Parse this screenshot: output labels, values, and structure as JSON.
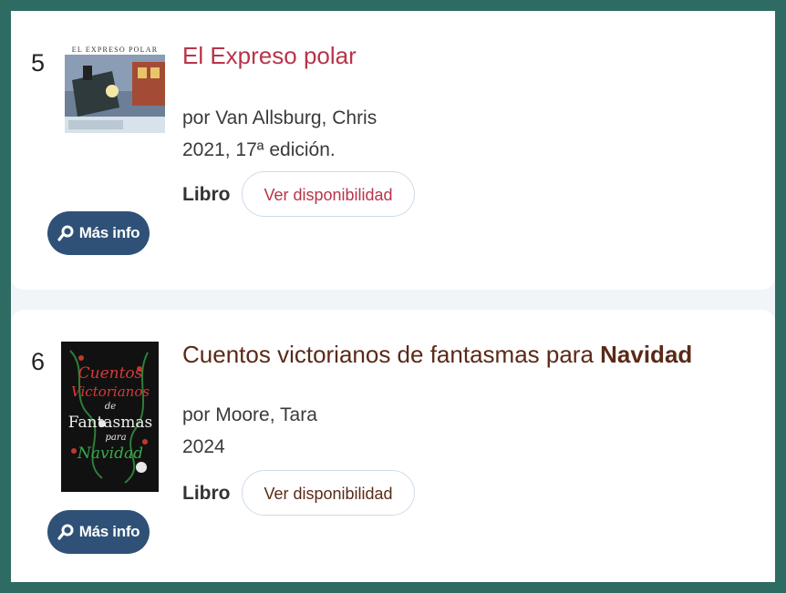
{
  "results": [
    {
      "number": "5",
      "title": "El Expreso polar",
      "title_plain": "El Expreso polar",
      "title_highlight": "",
      "author_prefix": "por",
      "author": "Van Allsburg, Chris",
      "edition": "2021, 17ª edición.",
      "type": "Libro",
      "availability_label": "Ver disponibilidad",
      "more_info_label": "Más info",
      "cover_text": "EL EXPRESO POLAR"
    },
    {
      "number": "6",
      "title_plain": "Cuentos victorianos de fantasmas para ",
      "title_highlight": "Navidad",
      "author_prefix": "por",
      "author": "Moore, Tara",
      "edition": "2024",
      "type": "Libro",
      "availability_label": "Ver disponibilidad",
      "more_info_label": "Más info",
      "cover_text": [
        "Cuentos",
        "Victorianos",
        "de",
        "Fantasmas",
        "para",
        "Navidad"
      ]
    }
  ],
  "colors": {
    "frame": "#2e6b62",
    "title_link_1": "#b8344a",
    "title_link_2": "#5a2a18",
    "more_info_bg": "#2f5177"
  }
}
